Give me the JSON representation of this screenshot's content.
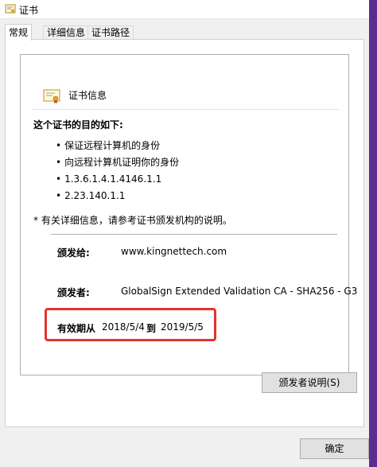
{
  "window": {
    "title": "证书"
  },
  "tabs": [
    {
      "label": "常规",
      "active": true
    },
    {
      "label": "详细信息",
      "active": false
    },
    {
      "label": "证书路径",
      "active": false
    }
  ],
  "cert_info": {
    "title": "证书信息",
    "purpose_title": "这个证书的目的如下:",
    "purposes": [
      "保证远程计算机的身份",
      "向远程计算机证明你的身份",
      "1.3.6.1.4.1.4146.1.1",
      "2.23.140.1.1"
    ],
    "note": "* 有关详细信息，请参考证书颁发机构的说明。"
  },
  "fields": {
    "issued_to_label": "颁发给:",
    "issued_to": "www.kingnettech.com",
    "issued_by_label": "颁发者:",
    "issued_by": "GlobalSign Extended Validation CA - SHA256 - G3",
    "valid_from_label": "有效期从",
    "valid_from": "2018/5/4",
    "valid_to_label": "到",
    "valid_to": "2019/5/5"
  },
  "buttons": {
    "issuer_statement": "颁发者说明(S)",
    "ok": "确定"
  },
  "colors": {
    "highlight": "#e3332b",
    "taskbar": "#5b2d8e"
  },
  "icons": {
    "title": "certificate-icon",
    "info": "certificate-icon"
  }
}
